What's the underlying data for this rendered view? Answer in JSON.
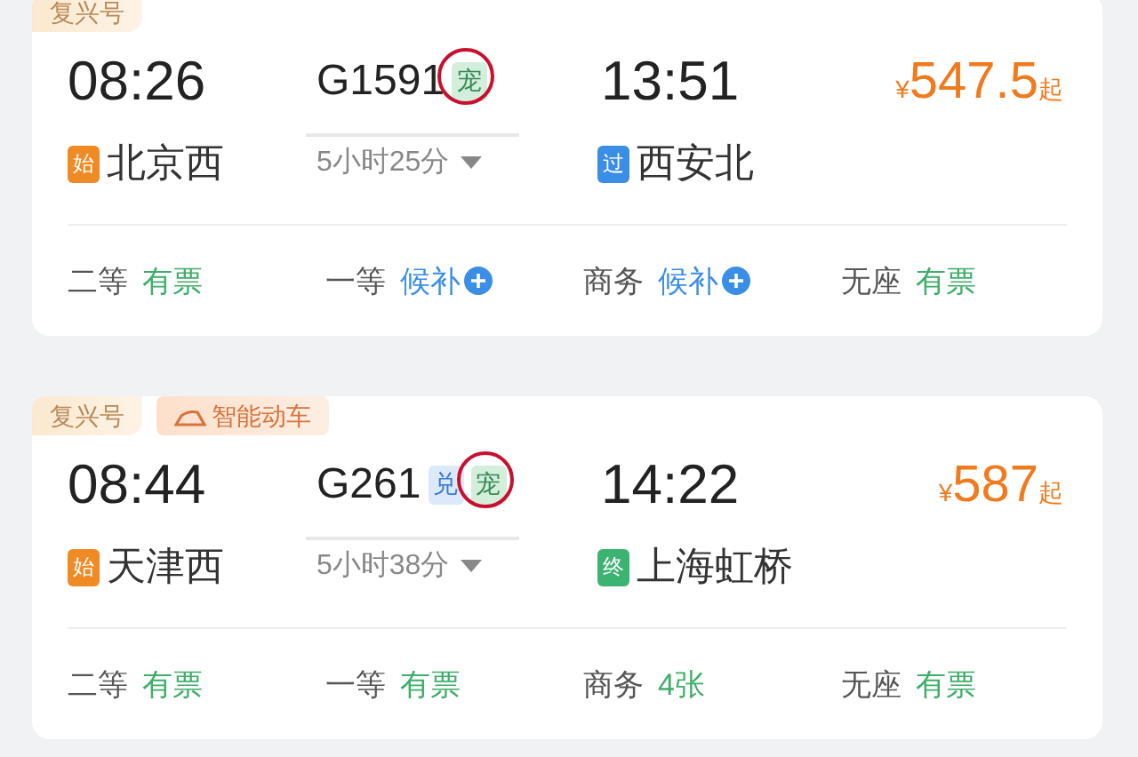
{
  "trains": [
    {
      "tags": [
        {
          "label": "复兴号",
          "kind": "fuxing"
        }
      ],
      "depart": {
        "time": "08:26",
        "station": "北京西",
        "badge": "始",
        "kind": "start"
      },
      "number": "G1591",
      "badges": [
        {
          "label": "宠",
          "kind": "pet",
          "highlighted": true
        }
      ],
      "duration": "5小时25分",
      "arrive": {
        "time": "13:51",
        "station": "西安北",
        "badge": "过",
        "kind": "pass"
      },
      "price": {
        "currency": "¥",
        "amount": "547.5",
        "suffix": "起"
      },
      "seats": [
        {
          "class": "二等",
          "status": "有票",
          "kind": "available"
        },
        {
          "class": "一等",
          "status": "候补",
          "kind": "waitlist"
        },
        {
          "class": "商务",
          "status": "候补",
          "kind": "waitlist"
        },
        {
          "class": "无座",
          "status": "有票",
          "kind": "available"
        }
      ]
    },
    {
      "tags": [
        {
          "label": "复兴号",
          "kind": "fuxing"
        },
        {
          "label": "智能动车",
          "kind": "smart"
        }
      ],
      "depart": {
        "time": "08:44",
        "station": "天津西",
        "badge": "始",
        "kind": "start"
      },
      "number": "G261",
      "badges": [
        {
          "label": "兑",
          "kind": "redeem",
          "highlighted": false
        },
        {
          "label": "宠",
          "kind": "pet",
          "highlighted": true
        }
      ],
      "duration": "5小时38分",
      "arrive": {
        "time": "14:22",
        "station": "上海虹桥",
        "badge": "终",
        "kind": "end"
      },
      "price": {
        "currency": "¥",
        "amount": "587",
        "suffix": "起"
      },
      "seats": [
        {
          "class": "二等",
          "status": "有票",
          "kind": "available"
        },
        {
          "class": "一等",
          "status": "有票",
          "kind": "available"
        },
        {
          "class": "商务",
          "status": "4张",
          "kind": "available"
        },
        {
          "class": "无座",
          "status": "有票",
          "kind": "available"
        }
      ]
    }
  ]
}
